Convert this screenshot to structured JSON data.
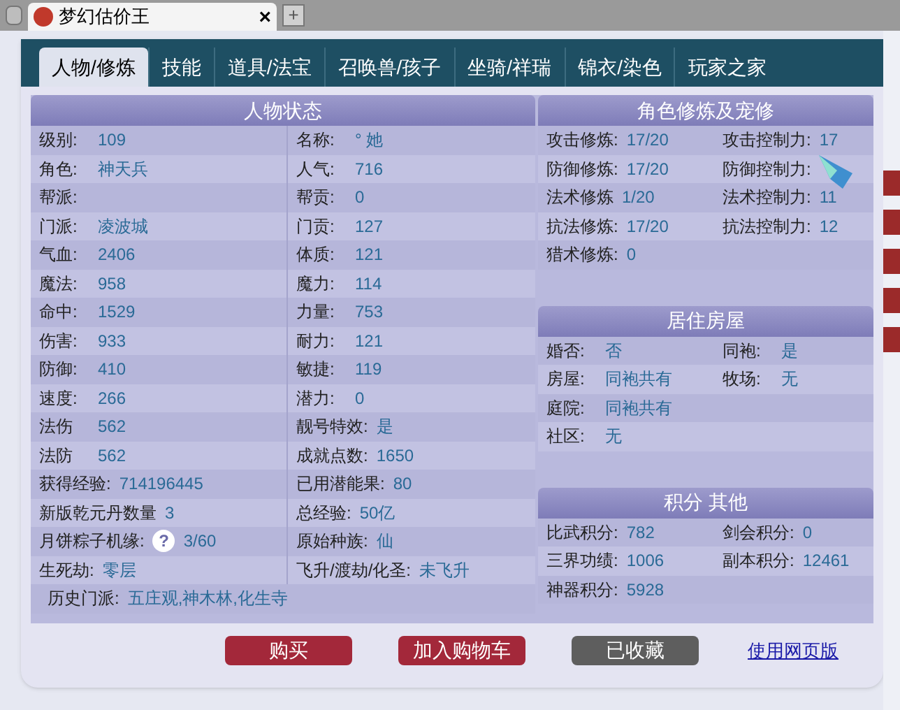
{
  "browser_tab": {
    "title": "梦幻估价王",
    "close": "×",
    "new_tab": "+"
  },
  "tabs": [
    {
      "label": "人物/修炼",
      "selected": true
    },
    {
      "label": "技能",
      "selected": false
    },
    {
      "label": "道具/法宝",
      "selected": false
    },
    {
      "label": "召唤兽/孩子",
      "selected": false
    },
    {
      "label": "坐骑/祥瑞",
      "selected": false
    },
    {
      "label": "锦衣/染色",
      "selected": false
    },
    {
      "label": "玩家之家",
      "selected": false
    }
  ],
  "character_status": {
    "title": "人物状态",
    "rows": [
      [
        {
          "label": "级别:",
          "value": "109"
        },
        {
          "label": "名称:",
          "value": "° 她"
        }
      ],
      [
        {
          "label": "角色:",
          "value": "神天兵"
        },
        {
          "label": "人气:",
          "value": "716"
        }
      ],
      [
        {
          "label": "帮派:"
        },
        {
          "label": "帮贡:",
          "value": "0"
        }
      ],
      [
        {
          "label": "门派:",
          "value": "凌波城"
        },
        {
          "label": "门贡:",
          "value": "127"
        }
      ],
      [
        {
          "label": "气血:",
          "value": "2406"
        },
        {
          "label": "体质:",
          "value": "121"
        }
      ],
      [
        {
          "label": "魔法:",
          "value": "958"
        },
        {
          "label": "魔力:",
          "value": "114"
        }
      ],
      [
        {
          "label": "命中:",
          "value": "1529"
        },
        {
          "label": "力量:",
          "value": "753"
        }
      ],
      [
        {
          "label": "伤害:",
          "value": "933"
        },
        {
          "label": "耐力:",
          "value": "121"
        }
      ],
      [
        {
          "label": "防御:",
          "value": "410"
        },
        {
          "label": "敏捷:",
          "value": "119"
        }
      ],
      [
        {
          "label": "速度:",
          "value": "266"
        },
        {
          "label": "潜力:",
          "value": "0"
        }
      ],
      [
        {
          "label": "法伤",
          "value": "562"
        },
        {
          "label": "靓号特效:",
          "value": "是"
        }
      ],
      [
        {
          "label": "法防",
          "value": "562"
        },
        {
          "label": "成就点数:",
          "value": "1650"
        }
      ],
      [
        {
          "label": "获得经验:",
          "value": "714196445"
        },
        {
          "label": "已用潜能果:",
          "value": "80"
        }
      ],
      [
        {
          "label": "新版乾元丹数量",
          "value": "3"
        },
        {
          "label": "总经验:",
          "value": "50亿"
        }
      ],
      [
        {
          "label": "月饼粽子机缘:",
          "help": "?",
          "value": "3/60"
        },
        {
          "label": "原始种族:",
          "value": "仙"
        }
      ],
      [
        {
          "label": "生死劫:",
          "value": "零层"
        },
        {
          "label": "飞升/渡劫/化圣:",
          "value": "未飞升"
        }
      ],
      [
        {
          "label": "历史门派:",
          "value": "五庄观,神木林,化生寺"
        }
      ]
    ]
  },
  "right_sections": [
    {
      "title": "角色修炼及宠修",
      "rows": [
        [
          {
            "label": "攻击修炼:",
            "value": "17/20"
          },
          {
            "label": "攻击控制力:",
            "value": "17"
          }
        ],
        [
          {
            "label": "防御修炼:",
            "value": "17/20"
          },
          {
            "label": "防御控制力:"
          }
        ],
        [
          {
            "label": "法术修炼",
            "value": "1/20"
          },
          {
            "label": "法术控制力:",
            "value": "11"
          }
        ],
        [
          {
            "label": "抗法修炼:",
            "value": "17/20"
          },
          {
            "label": "抗法控制力:",
            "value": "12"
          }
        ],
        [
          {
            "label": "猎术修炼:",
            "value": "0"
          }
        ]
      ]
    },
    {
      "title": "居住房屋",
      "rows": [
        [
          {
            "label": "婚否:",
            "value": "否"
          },
          {
            "label": "同袍:",
            "value": "是"
          }
        ],
        [
          {
            "label": "房屋:",
            "value": "同袍共有"
          },
          {
            "label": "牧场:",
            "value": "无"
          }
        ],
        [
          {
            "label": "庭院:",
            "value": "同袍共有"
          }
        ],
        [
          {
            "label": "社区:",
            "value": "无"
          }
        ]
      ]
    },
    {
      "title": "积分 其他",
      "rows": [
        [
          {
            "label": "比武积分:",
            "value": "782"
          },
          {
            "label": "剑会积分:",
            "value": "0"
          }
        ],
        [
          {
            "label": "三界功绩:",
            "value": "1006"
          },
          {
            "label": "副本积分:",
            "value": "12461"
          }
        ],
        [
          {
            "label": "神器积分:",
            "value": "5928"
          }
        ]
      ]
    }
  ],
  "buttons": [
    {
      "label": "购买",
      "kind": "primary"
    },
    {
      "label": "加入购物车",
      "kind": "primary"
    },
    {
      "label": "已收藏",
      "kind": "muted"
    }
  ],
  "link": "使用网页版"
}
